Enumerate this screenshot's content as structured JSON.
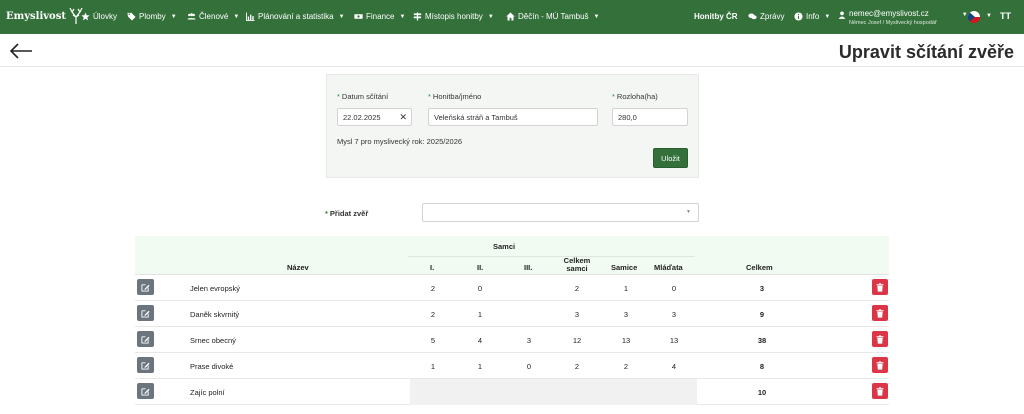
{
  "navbar": {
    "brand": "Emyslivost",
    "items": [
      {
        "label": "Úlovky",
        "icon": "star-icon",
        "dropdown": false
      },
      {
        "label": "Plomby",
        "icon": "tag-icon",
        "dropdown": true
      },
      {
        "label": "Členové",
        "icon": "users-icon",
        "dropdown": true
      },
      {
        "label": "Plánování a statistika",
        "icon": "chart-icon",
        "dropdown": true
      },
      {
        "label": "Finance",
        "icon": "money-icon",
        "dropdown": true
      },
      {
        "label": "Místopis honitby",
        "icon": "signpost-icon",
        "dropdown": true
      },
      {
        "label": "Děčín - MÚ Tambuš",
        "icon": "home-icon",
        "dropdown": true
      }
    ],
    "right": {
      "honitby": "Honitby ČR",
      "zpravy": "Zprávy",
      "info": "Info",
      "user_email": "nemec@emyslivost.cz",
      "user_sub": "Němec Josef / Myslivecký hospodář",
      "text_size": "TT"
    }
  },
  "page": {
    "title": "Upravit sčítání zvěře"
  },
  "form": {
    "date_label": "Datum sčítání",
    "date_value": "22.02.2025",
    "hunt_label": "Honitba/jméno",
    "hunt_value": "Veleňská stráň a Tambuš",
    "area_label": "Rozloha(ha)",
    "area_value": "280,0",
    "myslivecky_text": "Mysl 7 pro myslivecký rok: 2025/2026",
    "save_label": "Uložit",
    "add_label": "Přidat zvěř"
  },
  "table": {
    "headers": {
      "nazev": "Název",
      "samci": "Samci",
      "i": "I.",
      "ii": "II.",
      "iii": "III.",
      "celkem_samci": "Celkem samci",
      "samice": "Samice",
      "mladata": "Mláďata",
      "celkem": "Celkem"
    },
    "rows": [
      {
        "name": "Jelen evropský",
        "i": "2",
        "ii": "0",
        "iii": "",
        "celkem_samci": "2",
        "samice": "1",
        "mladata": "0",
        "celkem": "3"
      },
      {
        "name": "Daněk skvrnitý",
        "i": "2",
        "ii": "1",
        "iii": "",
        "celkem_samci": "3",
        "samice": "3",
        "mladata": "3",
        "celkem": "9"
      },
      {
        "name": "Srnec obecný",
        "i": "5",
        "ii": "4",
        "iii": "3",
        "celkem_samci": "12",
        "samice": "13",
        "mladata": "13",
        "celkem": "38"
      },
      {
        "name": "Prase divoké",
        "i": "1",
        "ii": "1",
        "iii": "0",
        "celkem_samci": "2",
        "samice": "2",
        "mladata": "4",
        "celkem": "8"
      },
      {
        "name": "Zajíc polní",
        "i": "",
        "ii": "",
        "iii": "",
        "celkem_samci": "",
        "samice": "",
        "mladata": "",
        "celkem": "10"
      }
    ]
  },
  "colors": {
    "navbar": "#33703a",
    "save_button": "#33703a",
    "delete_button": "#dc3545",
    "edit_button": "#6c757d",
    "table_header": "#f2fbf2"
  }
}
